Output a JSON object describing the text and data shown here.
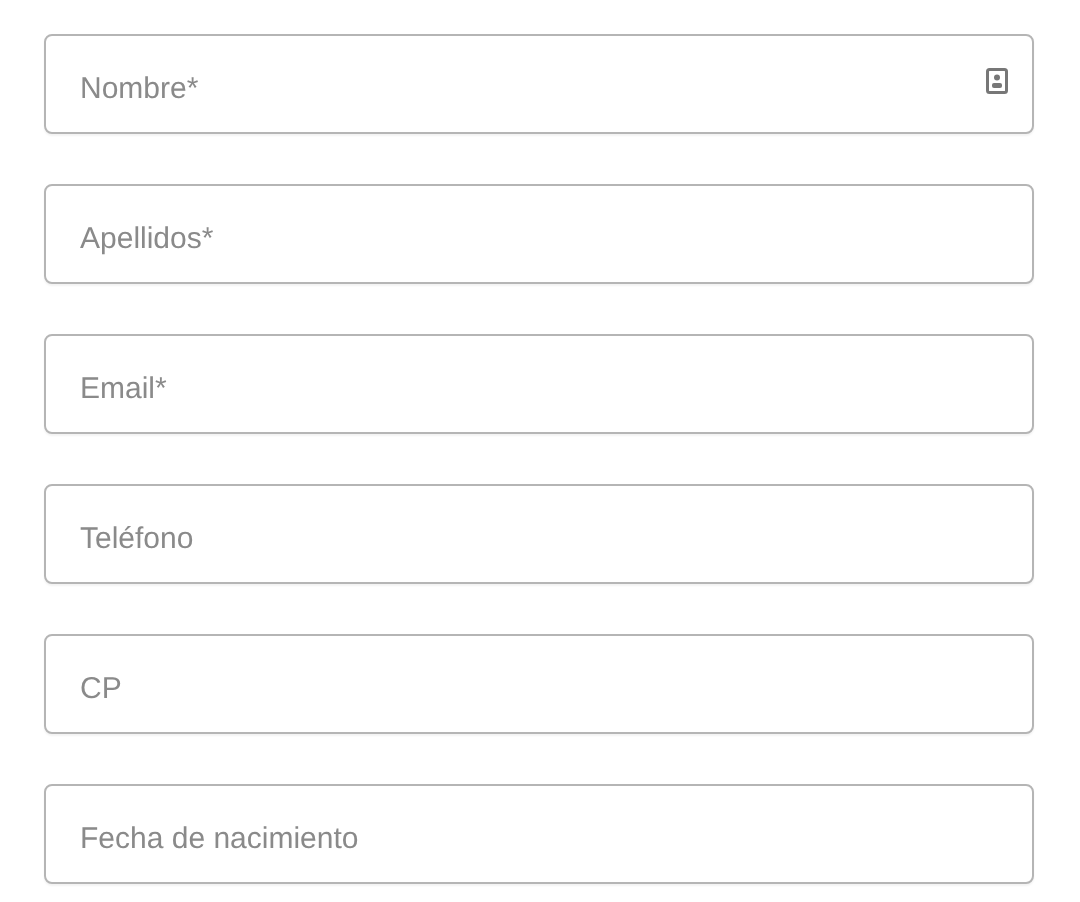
{
  "fields": [
    {
      "placeholder": "Nombre*",
      "kind": "autofill"
    },
    {
      "placeholder": "Apellidos*",
      "kind": "plain"
    },
    {
      "placeholder": "Email*",
      "kind": "plain"
    },
    {
      "placeholder": "Teléfono",
      "kind": "plain"
    },
    {
      "placeholder": "CP",
      "kind": "plain"
    },
    {
      "placeholder": "Fecha de nacimiento",
      "kind": "plain"
    }
  ]
}
